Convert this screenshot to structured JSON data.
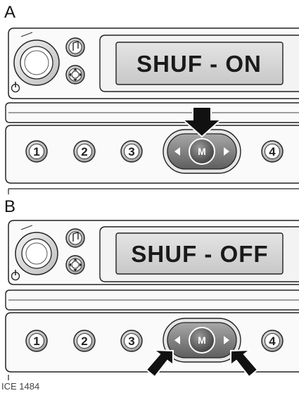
{
  "panels": [
    {
      "label": "A",
      "display_text": "SHUF - ON",
      "presets": [
        "1",
        "2",
        "3",
        "4"
      ],
      "mode_button": "M"
    },
    {
      "label": "B",
      "display_text": "SHUF - OFF",
      "presets": [
        "1",
        "2",
        "3",
        "4"
      ],
      "mode_button": "M"
    }
  ],
  "caption": "ICE 1484",
  "icons": [
    "power-icon",
    "music-note-icon",
    "cd-eject-icon",
    "press-arrow-icon",
    "left-arrow-icon",
    "right-arrow-icon"
  ]
}
